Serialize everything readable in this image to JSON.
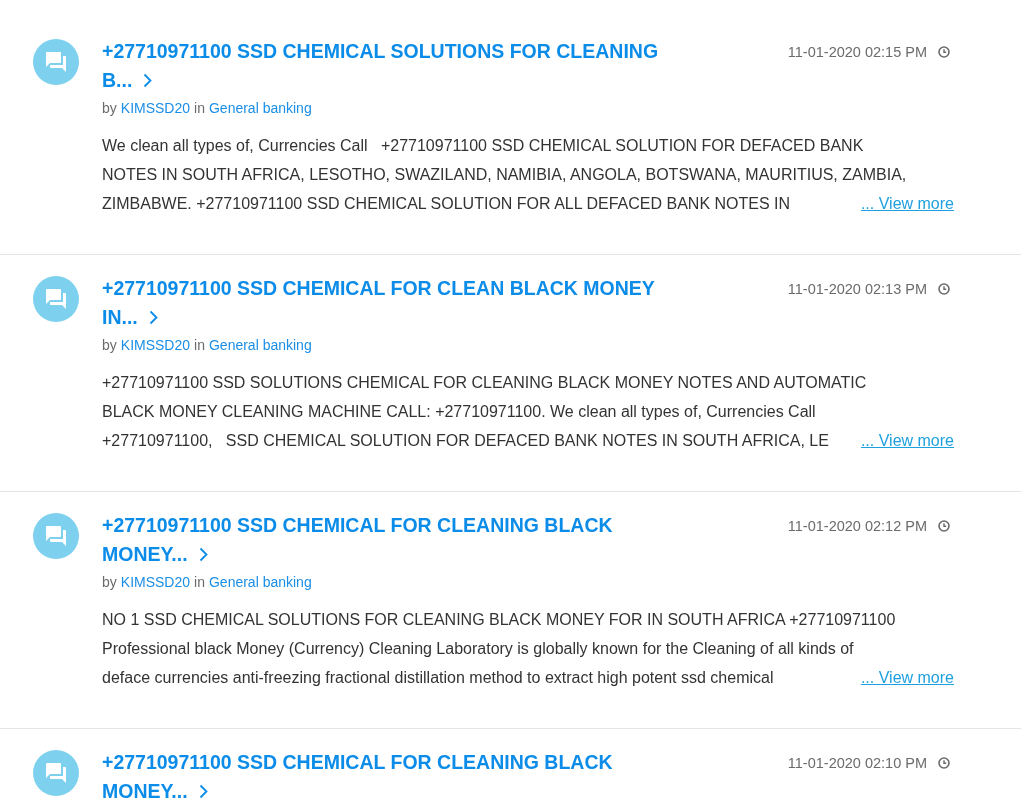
{
  "posts": [
    {
      "title_lines": [
        "+27710971100 SSD CHEMICAL SOLUTIONS FOR CLEANING",
        "B..."
      ],
      "timestamp": "11-01-2020 02:15 PM",
      "by_label": "by",
      "author": "KIMSSD20",
      "in_label": "in",
      "board": "General banking",
      "excerpt_lines": [
        "We clean all types of, Currencies Call   +27710971100 SSD CHEMICAL SOLUTION FOR DEFACED BANK",
        "NOTES IN SOUTH AFRICA, LESOTHO, SWAZILAND, NAMIBIA, ANGOLA, BOTSWANA, MAURITIUS, ZAMBIA,",
        "ZIMBABWE. +27710971100 SSD CHEMICAL SOLUTION FOR ALL DEFACED BANK NOTES IN"
      ],
      "more_link": "... View more"
    },
    {
      "title_lines": [
        "+27710971100 SSD CHEMICAL FOR CLEAN BLACK MONEY",
        "IN..."
      ],
      "timestamp": "11-01-2020 02:13 PM",
      "by_label": "by",
      "author": "KIMSSD20",
      "in_label": "in",
      "board": "General banking",
      "excerpt_lines": [
        "+27710971100 SSD SOLUTIONS CHEMICAL FOR CLEANING BLACK MONEY NOTES AND AUTOMATIC",
        "BLACK MONEY CLEANING MACHINE CALL: +27710971100. We clean all types of, Currencies Call",
        "+27710971100,   SSD CHEMICAL SOLUTION FOR DEFACED BANK NOTES IN SOUTH AFRICA, LE"
      ],
      "more_link": "... View more"
    },
    {
      "title_lines": [
        "+27710971100 SSD CHEMICAL FOR CLEANING BLACK",
        "MONEY..."
      ],
      "timestamp": "11-01-2020 02:12 PM",
      "by_label": "by",
      "author": "KIMSSD20",
      "in_label": "in",
      "board": "General banking",
      "excerpt_lines": [
        "NO 1 SSD CHEMICAL SOLUTIONS FOR CLEANING BLACK MONEY FOR IN SOUTH AFRICA +27710971100",
        "Professional black Money (Currency) Cleaning Laboratory is globally known for the Cleaning of all kinds of",
        "deface currencies anti-freezing fractional distillation method to extract high potent ssd chemical"
      ],
      "more_link": "... View more"
    },
    {
      "title_lines": [
        "+27710971100 SSD CHEMICAL FOR CLEANING BLACK",
        "MONEY..."
      ],
      "timestamp": "11-01-2020 02:10 PM"
    }
  ]
}
